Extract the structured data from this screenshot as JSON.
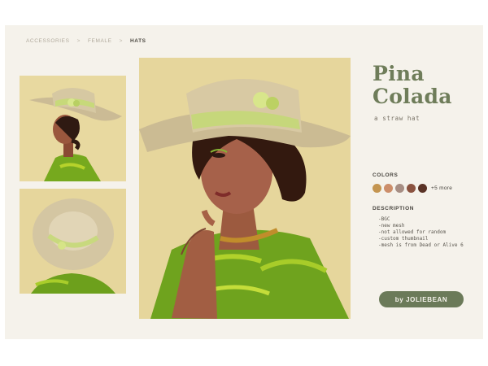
{
  "breadcrumb": {
    "items": [
      "ACCESSORIES",
      "FEMALE",
      "HATS"
    ],
    "separator": ">"
  },
  "title_lines": [
    "Pina",
    "Colada"
  ],
  "subtitle": "a straw hat",
  "colors": {
    "label": "COLORS",
    "swatches": [
      "#c49550",
      "#cc8e6a",
      "#a78e84",
      "#8b5340",
      "#5a3326"
    ],
    "more": "+5 more"
  },
  "description": {
    "label": "DESCRIPTION",
    "items": [
      "-BGC",
      "-new mesh",
      "-not allowed for random",
      "-custom thumbnail",
      "-mesh is from Dead or Alive 6"
    ]
  },
  "author_button": "by JOLIEBEAN",
  "images": {
    "thumbnail_1": "side-profile-straw-hat",
    "thumbnail_2": "top-view-straw-hat",
    "hero": "portrait-straw-hat"
  },
  "theme": {
    "accent": "#6b7a59",
    "title": "#6f7d5a",
    "card_background": "#f5f2eb",
    "image_background": "#e6d69d"
  }
}
